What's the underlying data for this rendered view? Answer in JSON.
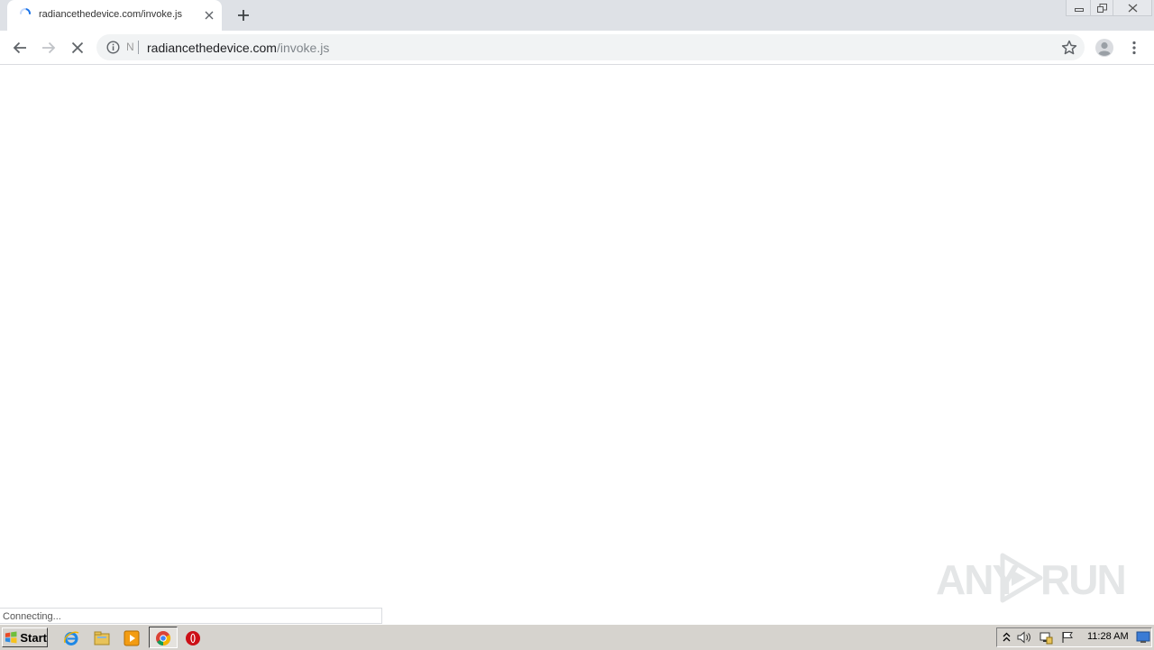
{
  "tab": {
    "title": "radiancethedevice.com/invoke.js"
  },
  "omnibox": {
    "chip_text": "N",
    "url_host": "radiancethedevice.com",
    "url_path": "/invoke.js"
  },
  "status": {
    "text": "Connecting..."
  },
  "watermark": {
    "left": "ANY",
    "right": "RUN"
  },
  "taskbar": {
    "start_label": "Start",
    "clock": "11:28 AM"
  },
  "colors": {
    "tabstrip": "#dee1e6",
    "omnibox": "#f1f3f4",
    "accent_blue": "#1a73e8",
    "taskbar": "#d6d3ce"
  }
}
